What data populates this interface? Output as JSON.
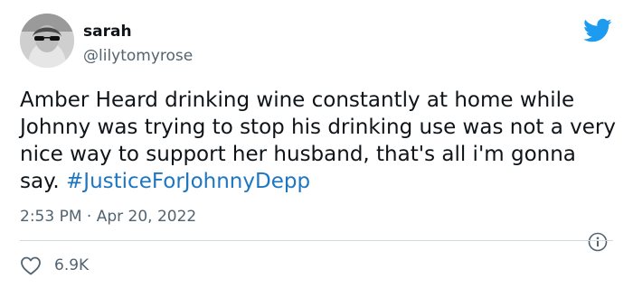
{
  "tweet": {
    "display_name": "sarah",
    "handle": "@lilytomyrose",
    "text": "Amber Heard drinking wine constantly at home while Johnny was trying to stop his drinking use was not a very nice way to support her husband, that's all i'm gonna say. ",
    "hashtag": "#JusticeForJohnnyDepp",
    "timestamp": "2:53 PM · Apr 20, 2022",
    "like_count": "6.9K"
  },
  "icons": {
    "brand": "twitter-bird-icon",
    "info": "info-icon",
    "like": "heart-icon"
  },
  "colors": {
    "brand_blue": "#1d9bf0",
    "hashtag_blue": "#1d76c2",
    "secondary_text": "#536471"
  }
}
